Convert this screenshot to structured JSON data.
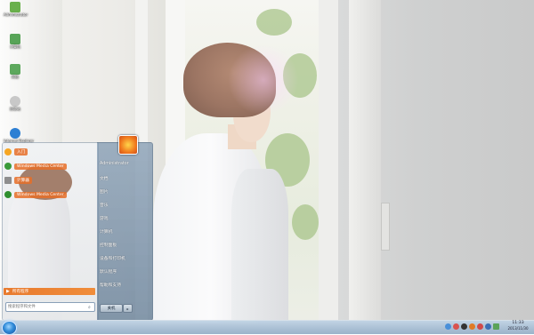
{
  "desktop": {
    "icons": [
      {
        "label": "Administrator",
        "icon": "user-folder-icon",
        "color": "#6ab04c"
      },
      {
        "label": "计算机",
        "icon": "computer-icon",
        "color": "#58a458"
      },
      {
        "label": "网络",
        "icon": "network-icon",
        "color": "#5da85d"
      },
      {
        "label": "回收站",
        "icon": "recycle-bin-icon",
        "color": "#c8c8c8"
      },
      {
        "label": "Internet Explorer",
        "icon": "ie-icon",
        "color": "#2d7fd3"
      }
    ]
  },
  "start_menu": {
    "pinned": [
      {
        "label": "入门",
        "icon": "getting-started-icon",
        "color": "#f6a623"
      },
      {
        "label": "Windows Media Center",
        "icon": "media-center-icon",
        "color": "#3a9a3a"
      },
      {
        "label": "计算器",
        "icon": "calculator-icon",
        "color": "#8e8e8e"
      },
      {
        "label": "Windows Media Center",
        "icon": "media-center-icon",
        "color": "#2f8f2f"
      }
    ],
    "all_programs": "所有程序",
    "search": {
      "placeholder": "搜索程序和文件"
    },
    "user_name": "Administrator",
    "right_items": [
      "文档",
      "图片",
      "音乐",
      "游戏",
      "计算机",
      "控制面板",
      "设备和打印机",
      "默认程序",
      "帮助和支持"
    ],
    "shutdown_label": "关机",
    "shutdown_arrow": "▸"
  },
  "taskbar": {
    "tray_icons": [
      {
        "name": "tray-network-icon",
        "color": "#4a90d9"
      },
      {
        "name": "tray-flag-icon",
        "color": "#d9534f"
      },
      {
        "name": "tray-qq-icon",
        "color": "#333333"
      },
      {
        "name": "tray-security-icon",
        "color": "#e07b26"
      },
      {
        "name": "tray-chat-icon",
        "color": "#d04a4a"
      },
      {
        "name": "tray-volume-icon",
        "color": "#3b6fb5"
      },
      {
        "name": "tray-battery-icon",
        "color": "#5aa35a"
      }
    ],
    "clock_time": "11:33",
    "clock_date": "2013/11/30"
  }
}
